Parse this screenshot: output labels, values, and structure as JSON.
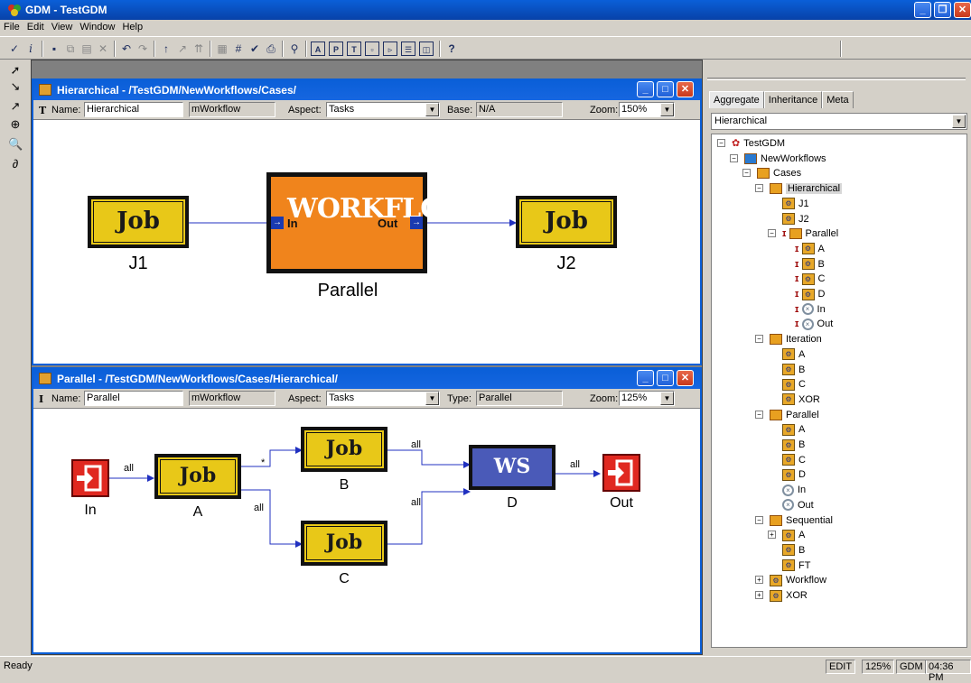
{
  "app": {
    "title": "GDM - TestGDM"
  },
  "menu": [
    "File",
    "Edit",
    "View",
    "Window",
    "Help"
  ],
  "toolbar_icons": [
    "check-icon",
    "info-icon",
    "save-icon",
    "copy-icon",
    "paste-icon",
    "delete-icon",
    "undo-icon",
    "redo-icon",
    "up-icon",
    "up-right-icon",
    "up-up-icon",
    "grid-icon",
    "hash-icon",
    "validate-icon",
    "print-icon",
    "find-icon",
    "a-icon",
    "p-icon",
    "t-icon",
    "box-icon",
    "layout-icon",
    "rows-icon",
    "panel-icon",
    "help-icon"
  ],
  "win1": {
    "title": "Hierarchical - /TestGDM/NewWorkflows/Cases/",
    "name_label": "Name:",
    "name_value": "Hierarchical",
    "kind_value": "mWorkflow",
    "aspect_label": "Aspect:",
    "aspect_value": "Tasks",
    "base_label": "Base:",
    "base_value": "N/A",
    "zoom_label": "Zoom:",
    "zoom_value": "150%",
    "nodes": {
      "job1": {
        "text": "Job",
        "caption": "J1"
      },
      "wf": {
        "text": "WORKFLOW",
        "caption": "Parallel",
        "in_port": "In",
        "out_port": "Out"
      },
      "job2": {
        "text": "Job",
        "caption": "J2"
      }
    }
  },
  "win2": {
    "title": "Parallel - /TestGDM/NewWorkflows/Cases/Hierarchical/",
    "name_label": "Name:",
    "name_value": "Parallel",
    "kind_value": "mWorkflow",
    "aspect_label": "Aspect:",
    "aspect_value": "Tasks",
    "type_label": "Type:",
    "type_value": "Parallel",
    "zoom_label": "Zoom:",
    "zoom_value": "125%",
    "nodes": {
      "in": {
        "caption": "In"
      },
      "a": {
        "text": "Job",
        "caption": "A"
      },
      "b": {
        "text": "Job",
        "caption": "B"
      },
      "c": {
        "text": "Job",
        "caption": "C"
      },
      "d": {
        "text": "WS",
        "caption": "D"
      },
      "out": {
        "caption": "Out"
      }
    },
    "edges": {
      "in_a": "all",
      "a_b": "*",
      "a_c": "all",
      "b_d": "all",
      "c_d": "all",
      "d_out": "all"
    }
  },
  "panel": {
    "tabs": [
      "Aggregate",
      "Inheritance",
      "Meta"
    ],
    "combo_value": "Hierarchical",
    "tree": [
      {
        "label": "TestGDM",
        "level": 0,
        "pm": "-",
        "icon": "root"
      },
      {
        "label": "NewWorkflows",
        "level": 1,
        "pm": "-",
        "icon": "folder-blue"
      },
      {
        "label": "Cases",
        "level": 2,
        "pm": "-",
        "icon": "folder"
      },
      {
        "label": "Hierarchical",
        "level": 3,
        "pm": "-",
        "icon": "folder",
        "selected": true
      },
      {
        "label": "J1",
        "level": 4,
        "icon": "atom"
      },
      {
        "label": "J2",
        "level": 4,
        "icon": "atom"
      },
      {
        "label": "Parallel",
        "level": 4,
        "pm": "-",
        "icon": "folder",
        "ref": true
      },
      {
        "label": "A",
        "level": 5,
        "icon": "atom",
        "ref": true
      },
      {
        "label": "B",
        "level": 5,
        "icon": "atom",
        "ref": true
      },
      {
        "label": "C",
        "level": 5,
        "icon": "atom",
        "ref": true
      },
      {
        "label": "D",
        "level": 5,
        "icon": "atom",
        "ref": true
      },
      {
        "label": "In",
        "level": 5,
        "icon": "port",
        "ref": true
      },
      {
        "label": "Out",
        "level": 5,
        "icon": "port",
        "ref": true
      },
      {
        "label": "Iteration",
        "level": 3,
        "pm": "-",
        "icon": "folder"
      },
      {
        "label": "A",
        "level": 4,
        "icon": "atom"
      },
      {
        "label": "B",
        "level": 4,
        "icon": "atom"
      },
      {
        "label": "C",
        "level": 4,
        "icon": "atom"
      },
      {
        "label": "XOR",
        "level": 4,
        "icon": "atom"
      },
      {
        "label": "Parallel",
        "level": 3,
        "pm": "-",
        "icon": "folder"
      },
      {
        "label": "A",
        "level": 4,
        "icon": "atom"
      },
      {
        "label": "B",
        "level": 4,
        "icon": "atom"
      },
      {
        "label": "C",
        "level": 4,
        "icon": "atom"
      },
      {
        "label": "D",
        "level": 4,
        "icon": "atom"
      },
      {
        "label": "In",
        "level": 4,
        "icon": "port"
      },
      {
        "label": "Out",
        "level": 4,
        "icon": "port"
      },
      {
        "label": "Sequential",
        "level": 3,
        "pm": "-",
        "icon": "folder"
      },
      {
        "label": "A",
        "level": 4,
        "pm": "+",
        "icon": "atom"
      },
      {
        "label": "B",
        "level": 4,
        "icon": "atom"
      },
      {
        "label": "FT",
        "level": 4,
        "icon": "atom"
      },
      {
        "label": "Workflow",
        "level": 3,
        "pm": "+",
        "icon": "atom"
      },
      {
        "label": "XOR",
        "level": 3,
        "pm": "+",
        "icon": "atom"
      }
    ]
  },
  "status": {
    "text": "Ready",
    "mode": "EDIT",
    "zoom": "125%",
    "app": "GDM",
    "time": "04:36 PM"
  }
}
